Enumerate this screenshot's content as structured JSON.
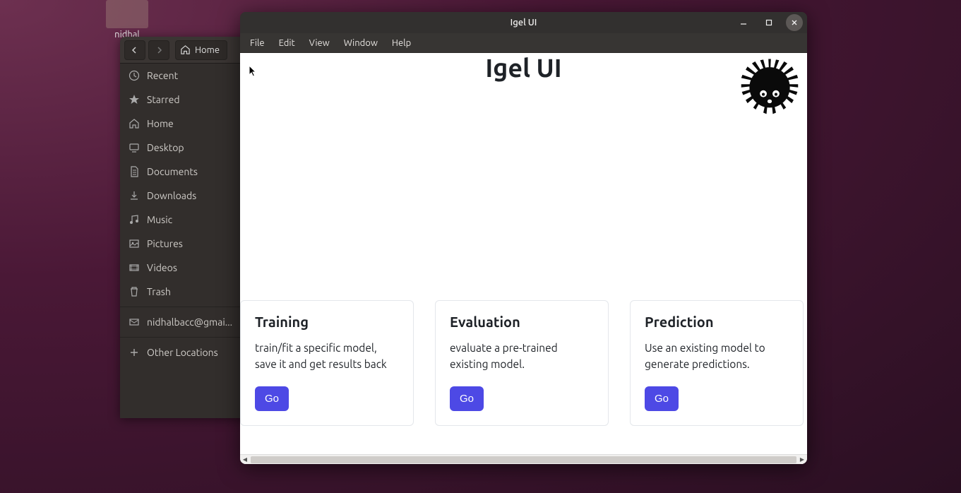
{
  "desktop": {
    "folder_label": "nidhal"
  },
  "files_window": {
    "breadcrumb": "Home",
    "sidebar": [
      {
        "label": "Recent",
        "icon": "clock"
      },
      {
        "label": "Starred",
        "icon": "star"
      },
      {
        "label": "Home",
        "icon": "home"
      },
      {
        "label": "Desktop",
        "icon": "desktop"
      },
      {
        "label": "Documents",
        "icon": "document"
      },
      {
        "label": "Downloads",
        "icon": "download"
      },
      {
        "label": "Music",
        "icon": "music"
      },
      {
        "label": "Pictures",
        "icon": "picture"
      },
      {
        "label": "Videos",
        "icon": "video"
      },
      {
        "label": "Trash",
        "icon": "trash"
      }
    ],
    "accounts": [
      {
        "label": "nidhalbacc@gmai..."
      }
    ],
    "other_locations": "Other Locations"
  },
  "igel": {
    "window_title": "Igel UI",
    "menu": [
      "File",
      "Edit",
      "View",
      "Window",
      "Help"
    ],
    "heading": "Igel UI",
    "cards": [
      {
        "title": "Training",
        "desc": "train/fit a specific model, save it and get results back",
        "button": "Go"
      },
      {
        "title": "Evaluation",
        "desc": "evaluate a pre-trained existing model.",
        "button": "Go"
      },
      {
        "title": "Prediction",
        "desc": "Use an existing model to generate predictions.",
        "button": "Go"
      }
    ]
  }
}
